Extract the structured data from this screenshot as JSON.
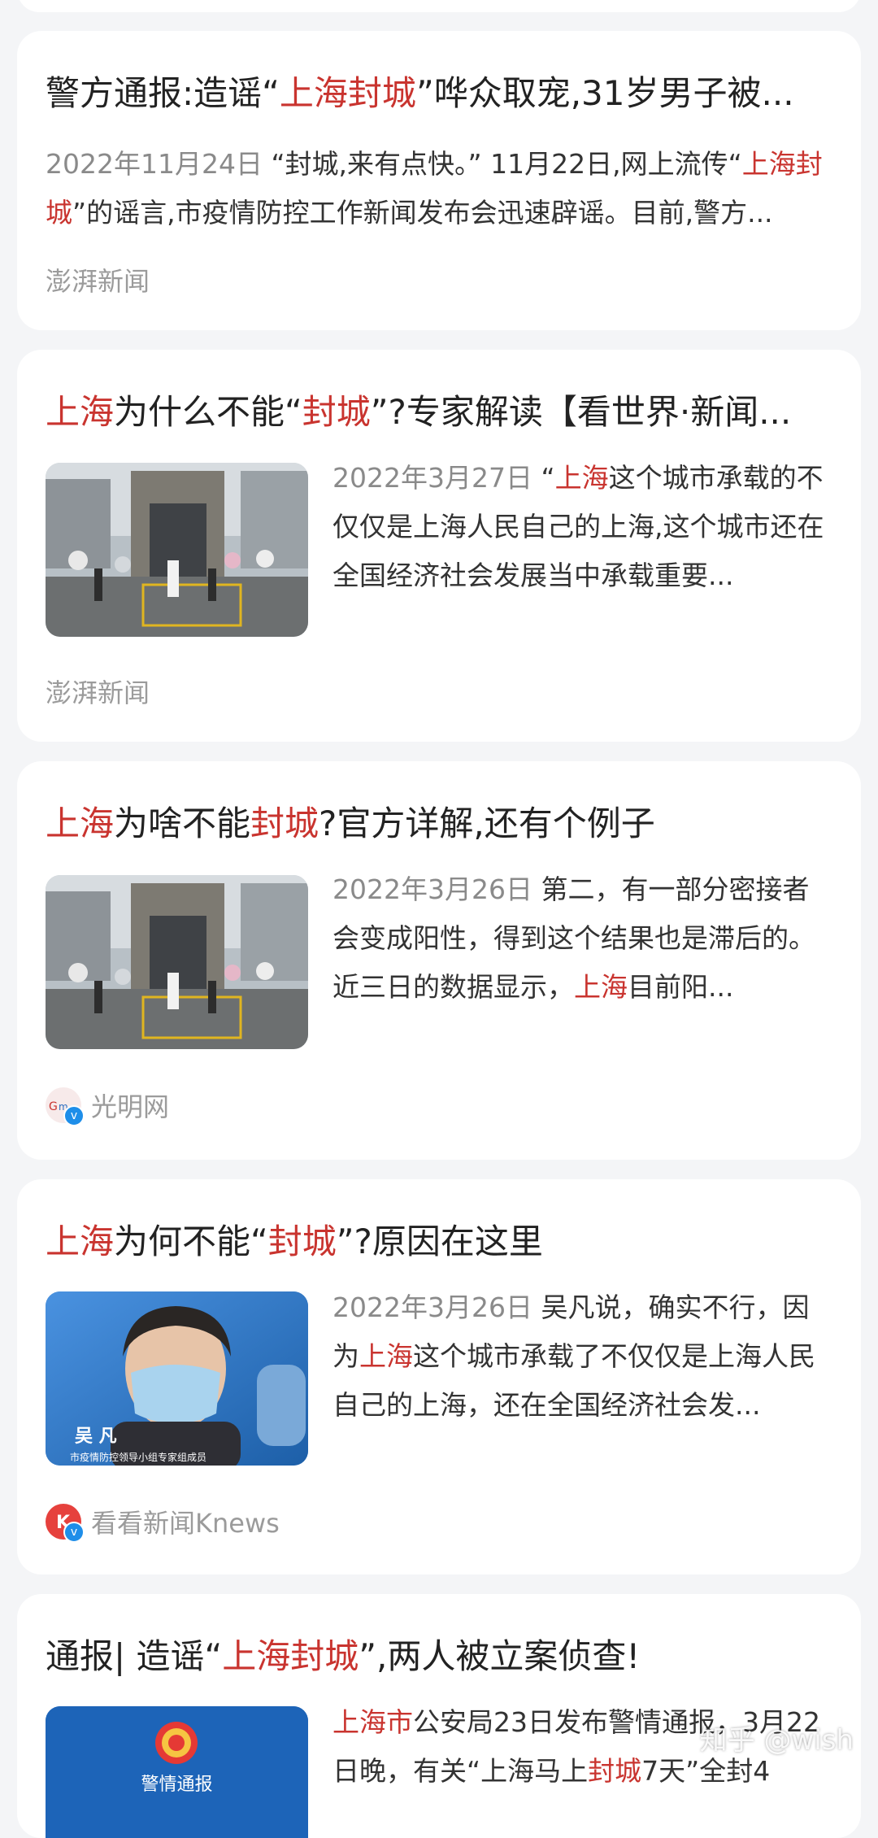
{
  "watermark": "知乎 @wish",
  "cards": [
    {
      "title_parts": [
        "警方通报:造谣“",
        "上海封城",
        "”哗众取宠,31岁男子被..."
      ],
      "date": "2022年11月24日",
      "body_parts": [
        " “封城,来有点快。” 11月22日,网上流传“",
        "上海封城",
        "”的谣言,市疫情防控工作新闻发布会迅速辟谣。目前,警方..."
      ],
      "source": "澎湃新闻"
    },
    {
      "title_parts": [
        "上海",
        "为什么不能“",
        "封城",
        "”?专家解读【看世界·新闻..."
      ],
      "date": "2022年3月27日",
      "body_parts": [
        " “",
        "上海",
        "这个城市承载的不仅仅是上海人民自己的上海,这个城市还在全国经济社会发展当中承载重要..."
      ],
      "source": "澎湃新闻",
      "thumb_icon": "city-gate-photo"
    },
    {
      "title_parts": [
        "上海",
        "为啥不能",
        "封城",
        "?官方详解,还有个例子"
      ],
      "date": "2022年3月26日",
      "body_parts": [
        " 第二，有一部分密接者会变成阳性，得到这个结果也是滞后的。近三日的数据显示，",
        "上海",
        "目前阳..."
      ],
      "source": "光明网",
      "thumb_icon": "city-gate-photo"
    },
    {
      "title_parts": [
        "上海",
        "为何不能“",
        "封城",
        "”?原因在这里"
      ],
      "date": "2022年3月26日",
      "body_parts": [
        " 吴凡说，确实不行，因为",
        "上海",
        "这个城市承载了不仅仅是上海人民自己的上海，还在全国经济社会发..."
      ],
      "source": "看看新闻Knews",
      "thumb_caption_name": "吴 凡",
      "thumb_caption_sub": "市疫情防控领导小组专家组成员"
    },
    {
      "title_parts": [
        "通报| 造谣“",
        "上海封城",
        "”,两人被立案侦查!"
      ],
      "body_parts": [
        "上海市",
        "公安局23日发布警情通报，3月22日晚，有关“上海马上",
        "封城",
        "7天”全封4"
      ],
      "thumb_caption": "警情通报"
    }
  ],
  "colors": {
    "highlight": "#c9342f",
    "background": "#f4f5f7",
    "card": "#ffffff"
  }
}
